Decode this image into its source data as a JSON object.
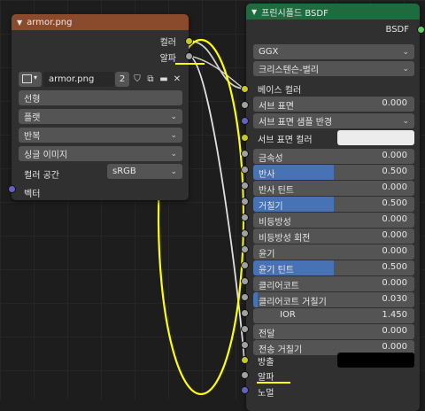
{
  "image_node": {
    "filename": "armor.png",
    "outputs": {
      "color": "컬러",
      "alpha": "알파"
    },
    "image_name": "armor.png",
    "users": "2",
    "interpolation": "선형",
    "projection": "플랫",
    "extension": "반복",
    "source": "싱글 이미지",
    "colorspace_label": "컬러 공간",
    "colorspace_value": "sRGB",
    "vector": "벡터"
  },
  "bsdf": {
    "title": "프린시플드 BSDF",
    "output": "BSDF",
    "distribution": "GGX",
    "subsurface_method": "크리스텐슨-벌리",
    "base_color": "베이스 컬러",
    "subsurface": {
      "label": "서브 표면",
      "value": "0.000"
    },
    "subsurface_radius": "서브 표면 샘플 반경",
    "subsurface_color": "서브 표면 컬러",
    "inputs": [
      {
        "label": "금속성",
        "value": "0.000",
        "fill": 0
      },
      {
        "label": "반사",
        "value": "0.500",
        "fill": 0.5
      },
      {
        "label": "반사 틴트",
        "value": "0.000",
        "fill": 0
      },
      {
        "label": "거칠기",
        "value": "0.500",
        "fill": 0.5
      },
      {
        "label": "비등방성",
        "value": "0.000",
        "fill": 0
      },
      {
        "label": "비등방성 회전",
        "value": "0.000",
        "fill": 0
      },
      {
        "label": "윤기",
        "value": "0.000",
        "fill": 0
      },
      {
        "label": "윤기 틴트",
        "value": "0.500",
        "fill": 0.5
      },
      {
        "label": "클리어코트",
        "value": "0.000",
        "fill": 0
      },
      {
        "label": "클리어코트 거칠기",
        "value": "0.030",
        "fill": 0.03
      },
      {
        "label": "IOR",
        "value": "1.450",
        "fill": 0
      },
      {
        "label": "전달",
        "value": "0.000",
        "fill": 0
      },
      {
        "label": "전송 거칠기",
        "value": "0.000",
        "fill": 0
      }
    ],
    "emission": "방출",
    "alpha": "알파",
    "normal": "노멀"
  },
  "colors": {
    "image_header": "#8a4a2c",
    "bsdf_header": "#1d6b3e",
    "annotation": "#ffff00"
  }
}
